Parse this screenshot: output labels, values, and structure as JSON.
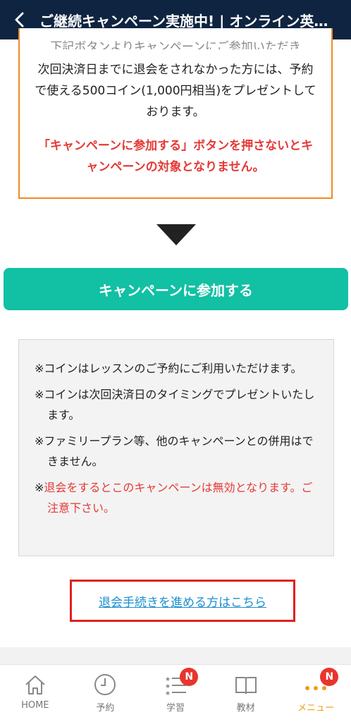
{
  "header": {
    "title": "ご継続キャンペーン実施中! | オンライン英会話ネイティブキャンプ"
  },
  "campaign": {
    "text_cut": "下記ボタンよりキャンペーンにご参加いただき",
    "text": "次回決済日までに退会をされなかった方には、予約で使える500コイン(1,000円相当)をプレゼントしております。",
    "warning": "「キャンペーンに参加する」ボタンを押さないとキャンペーンの対象となりません。"
  },
  "join_button": {
    "label": "キャンペーンに参加する"
  },
  "notes": {
    "items": [
      "※コインはレッスンのご予約にご利用いただけます。",
      "※コインは次回決済日のタイミングでプレゼントいたします。",
      "※ファミリープラン等、他のキャンペーンとの併用はできません。"
    ],
    "red_mark": "※",
    "red_text": "退会をするとこのキャンペーンは無効となります。ご注意下さい。"
  },
  "withdraw": {
    "label": "退会手続きを進める方はこちら"
  },
  "tabbar": {
    "items": [
      {
        "label": "HOME",
        "icon": "home-icon"
      },
      {
        "label": "予約",
        "icon": "clock-icon"
      },
      {
        "label": "学習",
        "icon": "list-stars-icon",
        "badge": "N"
      },
      {
        "label": "教材",
        "icon": "book-icon"
      },
      {
        "label": "メニュー",
        "icon": "dots-icon",
        "badge": "N",
        "active": true
      }
    ]
  },
  "colors": {
    "header_bg": "#0f2440",
    "accent_orange": "#ef8a26",
    "button_green": "#12c0a4",
    "warning_red": "#e53935",
    "link_blue": "#1a8fd0"
  }
}
